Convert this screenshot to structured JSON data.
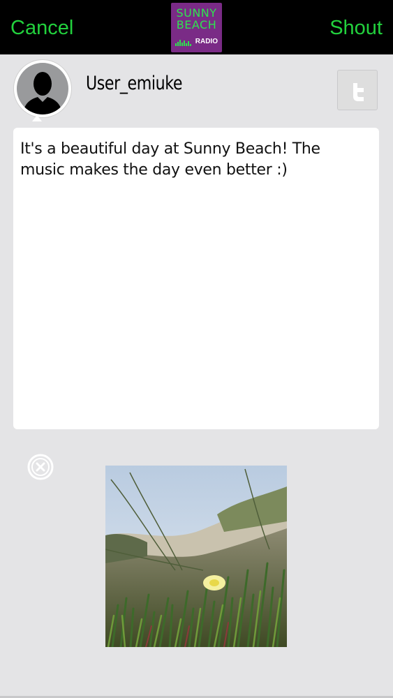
{
  "header": {
    "cancel_label": "Cancel",
    "shout_label": "Shout",
    "logo": {
      "line1": "SUNNY",
      "line2": "BEACH",
      "line3": "RADIO"
    }
  },
  "post": {
    "username": "User_emiuke",
    "message": "It's a beautiful day at Sunny Beach! The music makes the day even better :)"
  },
  "colors": {
    "accent": "#22d13d",
    "logo_bg": "#7a2b86",
    "header_bg": "#000000",
    "page_bg": "#e4e4e6"
  },
  "icons": {
    "avatar": "user-silhouette-icon",
    "twitter": "twitter-icon",
    "remove": "remove-circle-icon"
  }
}
